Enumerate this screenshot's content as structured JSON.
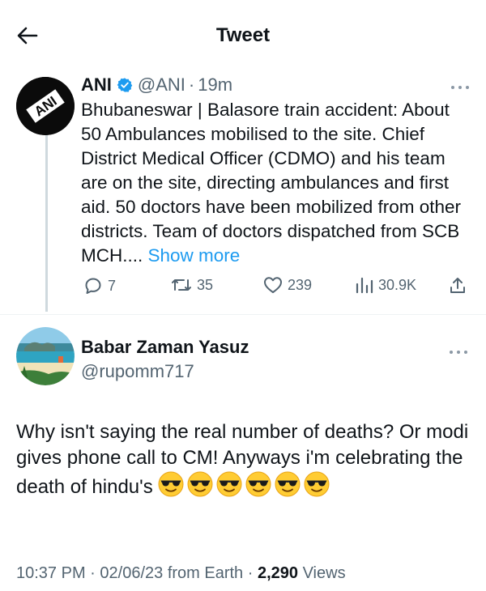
{
  "header": {
    "title": "Tweet",
    "back_icon": "arrow-left-icon"
  },
  "original_tweet": {
    "author_name": "ANI",
    "avatar_text": "ANI",
    "verified": true,
    "handle": "@ANI",
    "time": "19m",
    "text": "Bhubaneswar | Balasore train accident: About 50 Ambulances mobilised to the site. Chief District Medical Officer (CDMO) and his team are on the site, directing ambulances and first aid. 50 doctors have been mobilized from other districts. Team of doctors dispatched from SCB MCH....",
    "show_more": "Show more",
    "actions": {
      "replies": "7",
      "retweets": "35",
      "likes": "239",
      "views": "30.9K"
    },
    "accent_color": "#1d9bf0"
  },
  "reply": {
    "author_name": "Babar Zaman Yasuz",
    "handle": "@rupomm717",
    "text": "Why isn't saying the real number of deaths? Or modi gives phone call to CM! Anyways i'm celebrating the death  of hindu's",
    "emoji_name": "smiling-face-with-sunglasses",
    "emoji_count": 6,
    "time": "10:37 PM",
    "date": "02/06/23",
    "source": "from Earth",
    "views_count": "2,290",
    "views_label": "Views"
  }
}
